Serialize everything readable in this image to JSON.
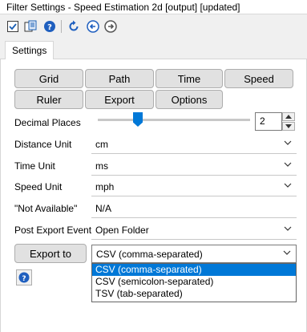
{
  "window": {
    "title": "Filter Settings - Speed Estimation 2d [output] [updated]"
  },
  "toolbar": {
    "icons": [
      "checkbox-icon",
      "copy-settings-icon",
      "help-icon",
      "reset-icon",
      "back-icon",
      "forward-icon"
    ]
  },
  "tabs": [
    {
      "label": "Settings"
    }
  ],
  "categories": [
    {
      "label": "Grid"
    },
    {
      "label": "Path"
    },
    {
      "label": "Time"
    },
    {
      "label": "Speed"
    },
    {
      "label": "Ruler"
    },
    {
      "label": "Export"
    },
    {
      "label": "Options"
    }
  ],
  "settings": {
    "decimal_places": {
      "label": "Decimal Places",
      "value": "2"
    },
    "distance_unit": {
      "label": "Distance Unit",
      "value": "cm"
    },
    "time_unit": {
      "label": "Time Unit",
      "value": "ms"
    },
    "speed_unit": {
      "label": "Speed Unit",
      "value": "mph"
    },
    "not_available": {
      "label": "\"Not Available\"",
      "value": "N/A"
    },
    "post_export_event": {
      "label": "Post Export Event",
      "value": "Open Folder"
    },
    "export_to": {
      "button_label": "Export to",
      "value": "CSV (comma-separated)",
      "options": [
        "CSV (comma-separated)",
        "CSV (semicolon-separated)",
        "TSV (tab-separated)"
      ]
    }
  },
  "colors": {
    "accent": "#0078d7",
    "selection": "#0078d7"
  }
}
